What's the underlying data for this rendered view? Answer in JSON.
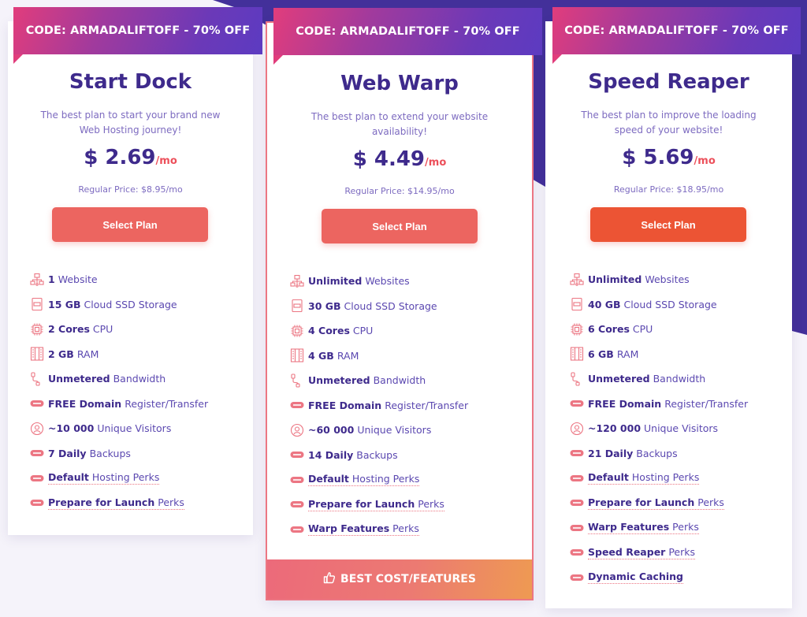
{
  "colors": {
    "brand_dark": "#3e2a8c",
    "accent_red": "#ec6560",
    "accent_orange": "#ec5434",
    "background_purple": "#43309a"
  },
  "plans": [
    {
      "promo": "CODE: ARMADALIFTOFF - 70% OFF",
      "title": "Start Dock",
      "description": "The best plan to start your brand new Web Hosting journey!",
      "price": "$ 2.69",
      "per": "/mo",
      "regular": "Regular Price: $8.95/mo",
      "button": "Select Plan",
      "features": [
        {
          "icon": "network-icon",
          "bold": "1",
          "text": "Website",
          "perk": false
        },
        {
          "icon": "ssd-icon",
          "bold": "15 GB",
          "text": "Cloud SSD Storage",
          "perk": false
        },
        {
          "icon": "cpu-icon",
          "bold": "2 Cores",
          "text": "CPU",
          "perk": false
        },
        {
          "icon": "ram-icon",
          "bold": "2 GB",
          "text": "RAM",
          "perk": false
        },
        {
          "icon": "cable-icon",
          "bold": "Unmetered",
          "text": "Bandwidth",
          "perk": false
        },
        {
          "icon": "free-badge-icon",
          "bold": "FREE Domain",
          "text": "Register/Transfer",
          "perk": false
        },
        {
          "icon": "visitor-icon",
          "bold": "~10 000",
          "text": "Unique Visitors",
          "perk": false
        },
        {
          "icon": "free-badge-icon",
          "bold": "7 Daily",
          "text": "Backups",
          "perk": false
        },
        {
          "icon": "free-badge-icon",
          "bold": "Default",
          "text": "Hosting Perks",
          "perk": true
        },
        {
          "icon": "free-badge-icon",
          "bold": "Prepare for Launch",
          "text": "Perks",
          "perk": true
        }
      ]
    },
    {
      "promo": "CODE: ARMADALIFTOFF - 70% OFF",
      "title": "Web Warp",
      "description": "The best plan to extend your website availability!",
      "price": "$ 4.49",
      "per": "/mo",
      "regular": "Regular Price: $14.95/mo",
      "button": "Select Plan",
      "best_label": "BEST COST/FEATURES",
      "features": [
        {
          "icon": "network-icon",
          "bold": "Unlimited",
          "text": "Websites",
          "perk": false
        },
        {
          "icon": "ssd-icon",
          "bold": "30 GB",
          "text": "Cloud SSD Storage",
          "perk": false
        },
        {
          "icon": "cpu-icon",
          "bold": "4 Cores",
          "text": "CPU",
          "perk": false
        },
        {
          "icon": "ram-icon",
          "bold": "4 GB",
          "text": "RAM",
          "perk": false
        },
        {
          "icon": "cable-icon",
          "bold": "Unmetered",
          "text": "Bandwidth",
          "perk": false
        },
        {
          "icon": "free-badge-icon",
          "bold": "FREE Domain",
          "text": "Register/Transfer",
          "perk": false
        },
        {
          "icon": "visitor-icon",
          "bold": "~60 000",
          "text": "Unique Visitors",
          "perk": false
        },
        {
          "icon": "free-badge-icon",
          "bold": "14 Daily",
          "text": "Backups",
          "perk": false
        },
        {
          "icon": "free-badge-icon",
          "bold": "Default",
          "text": "Hosting Perks",
          "perk": true
        },
        {
          "icon": "free-badge-icon",
          "bold": "Prepare for Launch",
          "text": "Perks",
          "perk": true
        },
        {
          "icon": "free-badge-icon",
          "bold": "Warp Features",
          "text": "Perks",
          "perk": true
        }
      ]
    },
    {
      "promo": "CODE: ARMADALIFTOFF - 70% OFF",
      "title": "Speed Reaper",
      "description": "The best plan to improve the loading speed of your website!",
      "price": "$ 5.69",
      "per": "/mo",
      "regular": "Regular Price: $18.95/mo",
      "button": "Select Plan",
      "features": [
        {
          "icon": "network-icon",
          "bold": "Unlimited",
          "text": "Websites",
          "perk": false
        },
        {
          "icon": "ssd-icon",
          "bold": "40 GB",
          "text": "Cloud SSD Storage",
          "perk": false
        },
        {
          "icon": "cpu-icon",
          "bold": "6 Cores",
          "text": "CPU",
          "perk": false
        },
        {
          "icon": "ram-icon",
          "bold": "6 GB",
          "text": "RAM",
          "perk": false
        },
        {
          "icon": "cable-icon",
          "bold": "Unmetered",
          "text": "Bandwidth",
          "perk": false
        },
        {
          "icon": "free-badge-icon",
          "bold": "FREE Domain",
          "text": "Register/Transfer",
          "perk": false
        },
        {
          "icon": "visitor-icon",
          "bold": "~120 000",
          "text": "Unique Visitors",
          "perk": false
        },
        {
          "icon": "free-badge-icon",
          "bold": "21 Daily",
          "text": "Backups",
          "perk": false
        },
        {
          "icon": "free-badge-icon",
          "bold": "Default",
          "text": "Hosting Perks",
          "perk": true
        },
        {
          "icon": "free-badge-icon",
          "bold": "Prepare for Launch",
          "text": "Perks",
          "perk": true
        },
        {
          "icon": "free-badge-icon",
          "bold": "Warp Features",
          "text": "Perks",
          "perk": true
        },
        {
          "icon": "free-badge-icon",
          "bold": "Speed Reaper",
          "text": "Perks",
          "perk": true
        },
        {
          "icon": "free-badge-icon",
          "bold": "Dynamic Caching",
          "text": "",
          "perk": true
        }
      ]
    }
  ]
}
